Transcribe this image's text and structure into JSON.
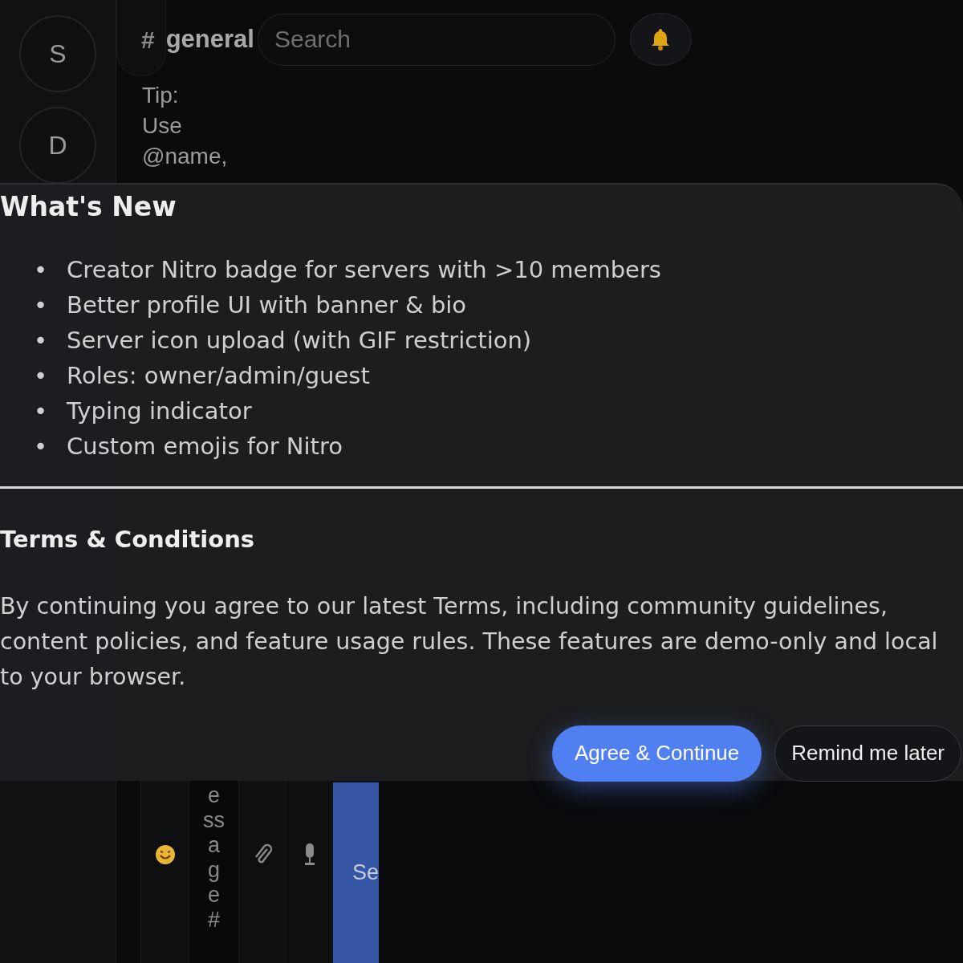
{
  "rail": {
    "servers": [
      {
        "initial": "S"
      },
      {
        "initial": "D"
      }
    ]
  },
  "header": {
    "hash": "#",
    "channel": "general",
    "search": {
      "placeholder": "Search"
    }
  },
  "tip": [
    "Tip:",
    "Use",
    "@name,"
  ],
  "composer": {
    "message": {
      "placeholder": "essage#"
    },
    "send": "Se"
  },
  "modal": {
    "title": "What's New",
    "items": [
      {
        "marker": "•",
        "text": "Creator Nitro badge for servers with >10 members"
      },
      {
        "marker": "•",
        "text": "Better profile UI with banner & bio"
      },
      {
        "marker": "•",
        "text": "Server icon upload (with GIF restriction)"
      },
      {
        "marker": "•",
        "text": "Roles: owner/admin/guest"
      },
      {
        "marker": "•",
        "text": "Typing indicator"
      },
      {
        "marker": "•",
        "text": "Custom emojis for Nitro"
      }
    ],
    "terms_title": "Terms & Conditions",
    "terms_text": "By continuing you agree to our latest Terms, including community guidelines, content policies, and feature usage rules. These features are demo-only and local to your browser.",
    "buttons": [
      {
        "label": "Agree & Continue",
        "kind": "primary"
      },
      {
        "label": "Remind me later",
        "kind": "secondary"
      }
    ]
  }
}
